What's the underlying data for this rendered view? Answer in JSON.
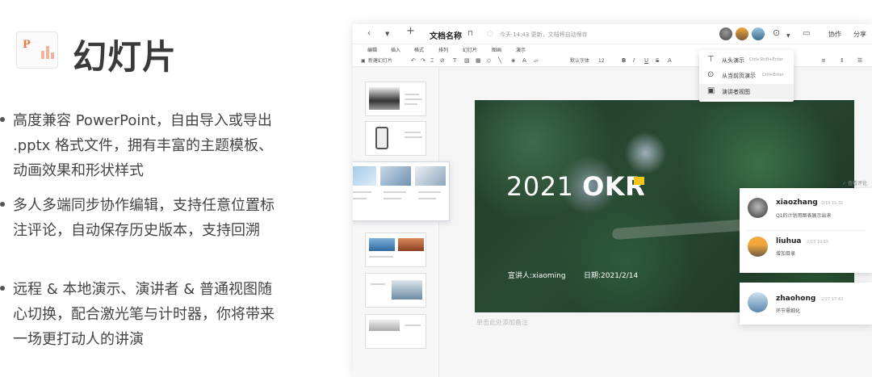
{
  "hero": {
    "title": "幻灯片",
    "icon_letter": "P",
    "features": [
      "高度兼容 PowerPoint，自由导入或导出 .pptx 格式文件，拥有丰富的主题模板、动画效果和形状样式",
      "多人多端同步协作编辑，支持任意位置标注评论，自动保存历史版本，支持回溯",
      "远程 & 本地演示、演讲者 & 普通视图随心切换，配合激光笔与计时器，你将带来一场更打动人的讲演"
    ]
  },
  "editor": {
    "doc_name": "文档名称",
    "save_status": "今天 14:43 更新，文档将自动保存",
    "collab_label": "协作",
    "share_label": "分享",
    "menu": [
      "编辑",
      "插入",
      "格式",
      "排列",
      "幻灯片",
      "图画",
      "演示"
    ],
    "toolbar": {
      "new_slide": "新建幻灯片",
      "font_name": "默认字体",
      "font_size": "12"
    },
    "play_menu": [
      {
        "label": "从头演示",
        "shortcut": "Ctrl+Shift+Enter",
        "icon": "presentation-icon"
      },
      {
        "label": "从当前页演示",
        "shortcut": "Ctrl+Enter",
        "icon": "play-circle-icon"
      },
      {
        "label": "演讲者视图",
        "shortcut": "",
        "icon": "presenter-view-icon"
      }
    ],
    "slide": {
      "title_year": "2021",
      "title_main": "OKR",
      "presenter": "宣讲人:xiaoming",
      "date": "日期:2021/2/14"
    },
    "notes_hint": "单击此处添加备注",
    "comments_header": "✓ 查看评论",
    "comments": [
      {
        "name": "xiaozhang",
        "time": "2/19 15:32",
        "text": "Q1的计划用图表展示出来"
      },
      {
        "name": "liuhua",
        "time": "2/23 10:15",
        "text": "增加目录"
      },
      {
        "name": "zhaohong",
        "time": "2/27 17:43",
        "text": "环节需细化"
      }
    ],
    "colors": {
      "accent_yellow": "#f5c518",
      "forest_dark": "#1f3b29"
    }
  }
}
